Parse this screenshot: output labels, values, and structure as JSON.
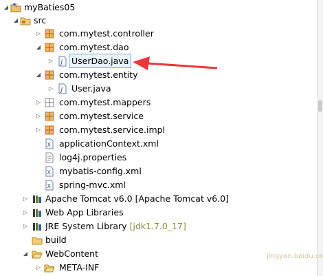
{
  "tree": {
    "items": [
      {
        "label": "myBaties05",
        "decoration": "",
        "icon": "project-icon",
        "twisty": "expanded"
      },
      {
        "label": "src",
        "decoration": "",
        "icon": "source-folder-icon",
        "twisty": "expanded"
      },
      {
        "label": "com.mytest.controller",
        "decoration": "",
        "icon": "package-icon",
        "twisty": "collapsed"
      },
      {
        "label": "com.mytest.dao",
        "decoration": "",
        "icon": "package-icon",
        "twisty": "expanded"
      },
      {
        "label": "UserDao.java",
        "decoration": "",
        "icon": "java-file-icon",
        "twisty": "collapsed"
      },
      {
        "label": "com.mytest.entity",
        "decoration": "",
        "icon": "package-icon",
        "twisty": "expanded"
      },
      {
        "label": "User.java",
        "decoration": "",
        "icon": "java-file-icon",
        "twisty": "collapsed"
      },
      {
        "label": "com.mytest.mappers",
        "decoration": "",
        "icon": "package-empty-icon",
        "twisty": "collapsed"
      },
      {
        "label": "com.mytest.service",
        "decoration": "",
        "icon": "package-icon",
        "twisty": "collapsed"
      },
      {
        "label": "com.mytest.service.impl",
        "decoration": "",
        "icon": "package-icon",
        "twisty": "collapsed"
      },
      {
        "label": "applicationContext.xml",
        "decoration": "",
        "icon": "xml-file-icon",
        "twisty": "none"
      },
      {
        "label": "log4j.properties",
        "decoration": "",
        "icon": "properties-file-icon",
        "twisty": "none"
      },
      {
        "label": "mybatis-config.xml",
        "decoration": "",
        "icon": "xml-file-icon",
        "twisty": "none"
      },
      {
        "label": "spring-mvc.xml",
        "decoration": "",
        "icon": "xml-file-icon",
        "twisty": "none"
      },
      {
        "label": "Apache Tomcat v6.0 [Apache Tomcat v6.0]",
        "decoration": "",
        "icon": "library-icon",
        "twisty": "collapsed"
      },
      {
        "label": "Web App Libraries",
        "decoration": "",
        "icon": "library-icon",
        "twisty": "collapsed"
      },
      {
        "label": "JRE System Library ",
        "decoration": "[jdk1.7.0_17]",
        "icon": "library-icon",
        "twisty": "collapsed"
      },
      {
        "label": "build",
        "decoration": "",
        "icon": "folder-icon",
        "twisty": "none"
      },
      {
        "label": "WebContent",
        "decoration": "",
        "icon": "folder-open-icon",
        "twisty": "expanded"
      },
      {
        "label": "META-INF",
        "decoration": "",
        "icon": "folder-icon",
        "twisty": "collapsed"
      }
    ]
  },
  "colors": {
    "arrow": "#e8383d",
    "selection_border": "#7da2ce",
    "package": "#c8741b",
    "decoration": "#8b8b3a"
  },
  "watermark": "jingyan.baidu.com"
}
